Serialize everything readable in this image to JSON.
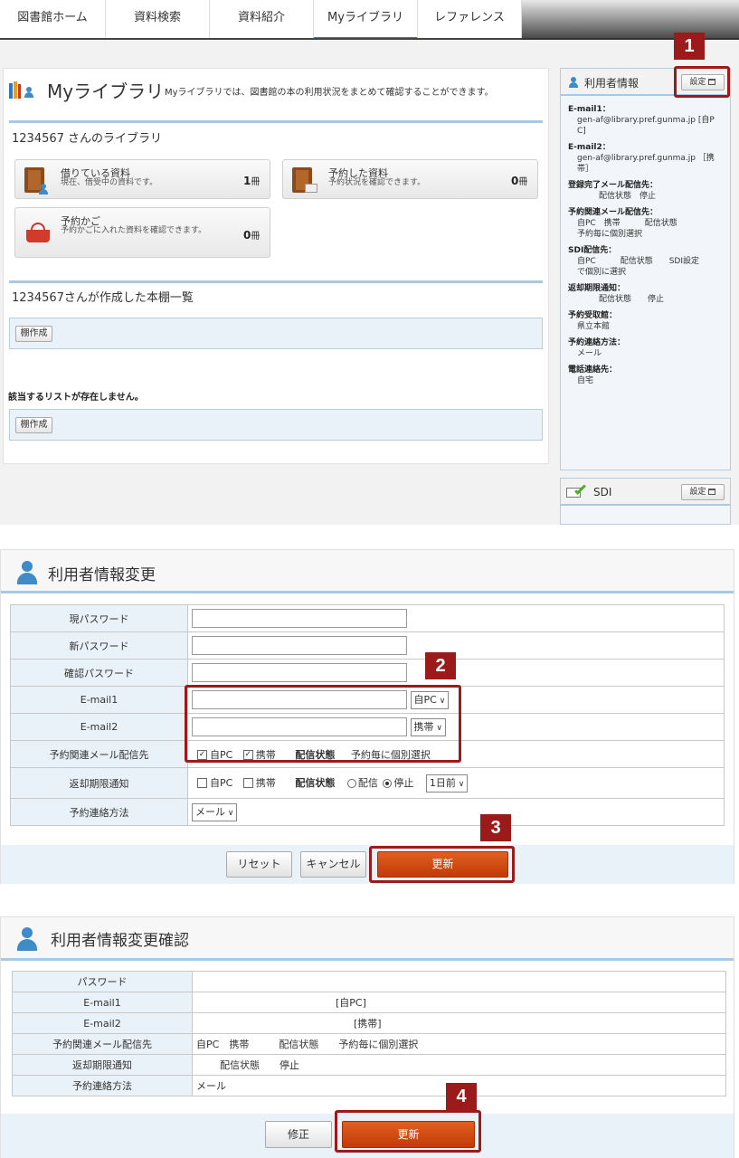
{
  "nav": {
    "tabs": [
      "図書館ホーム",
      "資料検索",
      "資料紹介",
      "Myライブラリ",
      "レファレンス"
    ]
  },
  "mylib": {
    "title": "Myライブラリ",
    "desc": "Myライブラリでは、図書館の本の利用状況をまとめて確認することができます。",
    "library_head": "1234567 さんのライブラリ",
    "borrowed": {
      "title": "借りている資料",
      "sub": "現在、借受中の資料です。",
      "count": "1",
      "unit": "冊"
    },
    "reserved": {
      "title": "予約した資料",
      "sub": "予約状況を確認できます。",
      "count": "0",
      "unit": "冊"
    },
    "basket": {
      "title": "予約かご",
      "sub": "予約かごに入れた資料を確認できます。",
      "count": "0",
      "unit": "冊"
    },
    "shelf_head": "1234567さんが作成した本棚一覧",
    "shelf_btn": "棚作成",
    "no_list": "該当するリストが存在しません。",
    "shelf_btn2": "棚作成"
  },
  "userinfo": {
    "title": "利用者情報",
    "settings": "設定",
    "lines": [
      {
        "t": "E-mail1：",
        "b": true
      },
      {
        "t": "gen-af@library.pref.gunma.jp [自P",
        "b": false
      },
      {
        "t": "C]",
        "b": false
      },
      {
        "t": "E-mail2：",
        "b": true
      },
      {
        "t": "gen-af@library.pref.gunma.jp ［携",
        "b": false
      },
      {
        "t": "帯］",
        "b": false
      },
      {
        "t": "登録完了メール配信先：",
        "b": true
      },
      {
        "t": "配信状態　停止",
        "b": false
      },
      {
        "t": "予約関連メール配信先：",
        "b": true
      },
      {
        "t": "自PC　携帯　　　配信状態",
        "b": false
      },
      {
        "t": "予約毎に個別選択",
        "b": false
      },
      {
        "t": "SDI配信先：",
        "b": true
      },
      {
        "t": "自PC　　　配信状態　　SDI設定",
        "b": false
      },
      {
        "t": "で個別に選択",
        "b": false
      },
      {
        "t": "返却期限通知：",
        "b": true
      },
      {
        "t": "配信状態　　停止",
        "b": false
      },
      {
        "t": "予約受取館：",
        "b": true
      },
      {
        "t": "県立本館",
        "b": false
      },
      {
        "t": "予約連絡方法：",
        "b": true
      },
      {
        "t": "メール",
        "b": false
      },
      {
        "t": "電話連絡先：",
        "b": true
      },
      {
        "t": "自宅",
        "b": false
      }
    ]
  },
  "sdi": {
    "title": "SDI",
    "settings": "設定"
  },
  "markers": [
    "1",
    "2",
    "3",
    "4"
  ],
  "form": {
    "title": "利用者情報変更",
    "rows": {
      "cur_pw": "現パスワード",
      "new_pw": "新パスワード",
      "conf_pw": "確認パスワード",
      "email1": "E-mail1",
      "email2": "E-mail2",
      "resv_mail": "予約関連メール配信先",
      "due": "返却期限通知",
      "contact": "予約連絡方法"
    },
    "email1_sel": "自PC",
    "email2_sel": "携帯",
    "resv": {
      "pc": "自PC",
      "mobile": "携帯",
      "status_label": "配信状態",
      "status": "予約毎に個別選択"
    },
    "due_opts": {
      "pc": "自PC",
      "mobile": "携帯",
      "status_label": "配信状態",
      "on": "配信",
      "off": "停止",
      "days": "1日前"
    },
    "contact_sel": "メール",
    "reset": "リセット",
    "cancel": "キャンセル",
    "update": "更新"
  },
  "confirm": {
    "title": "利用者情報変更確認",
    "rows": [
      {
        "label": "パスワード",
        "value": ""
      },
      {
        "label": "E-mail1",
        "value": "[自PC]"
      },
      {
        "label": "E-mail2",
        "value": "[携帯]"
      },
      {
        "label": "予約関連メール配信先",
        "value": "自PC　携帯　　　配信状態　　予約毎に個別選択"
      },
      {
        "label": "返却期限通知",
        "value": "配信状態　　停止"
      },
      {
        "label": "予約連絡方法",
        "value": "メール"
      }
    ],
    "fix": "修正",
    "update": "更新"
  }
}
